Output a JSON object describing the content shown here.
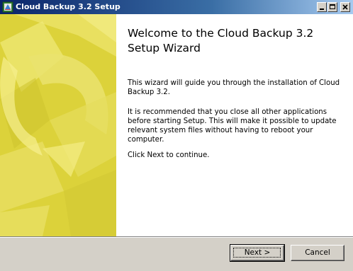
{
  "window": {
    "title": "Cloud Backup 3.2 Setup",
    "icons": {
      "app": "installer-icon",
      "minimize": "minimize-icon",
      "maximize": "maximize-icon",
      "close": "close-icon"
    }
  },
  "banner": {
    "colors": {
      "base": "#dcd23a",
      "light": "#f2ea6e",
      "dark": "#c9be2a"
    }
  },
  "content": {
    "heading": "Welcome to the Cloud Backup 3.2 Setup Wizard",
    "paragraph1": "This wizard will guide you through the installation of Cloud Backup 3.2.",
    "paragraph2": "It is recommended that you close all other applications before starting Setup. This will make it possible to update relevant system files without having to reboot your computer.",
    "paragraph3": "Click Next to continue."
  },
  "buttons": {
    "next": "Next >",
    "cancel": "Cancel"
  }
}
